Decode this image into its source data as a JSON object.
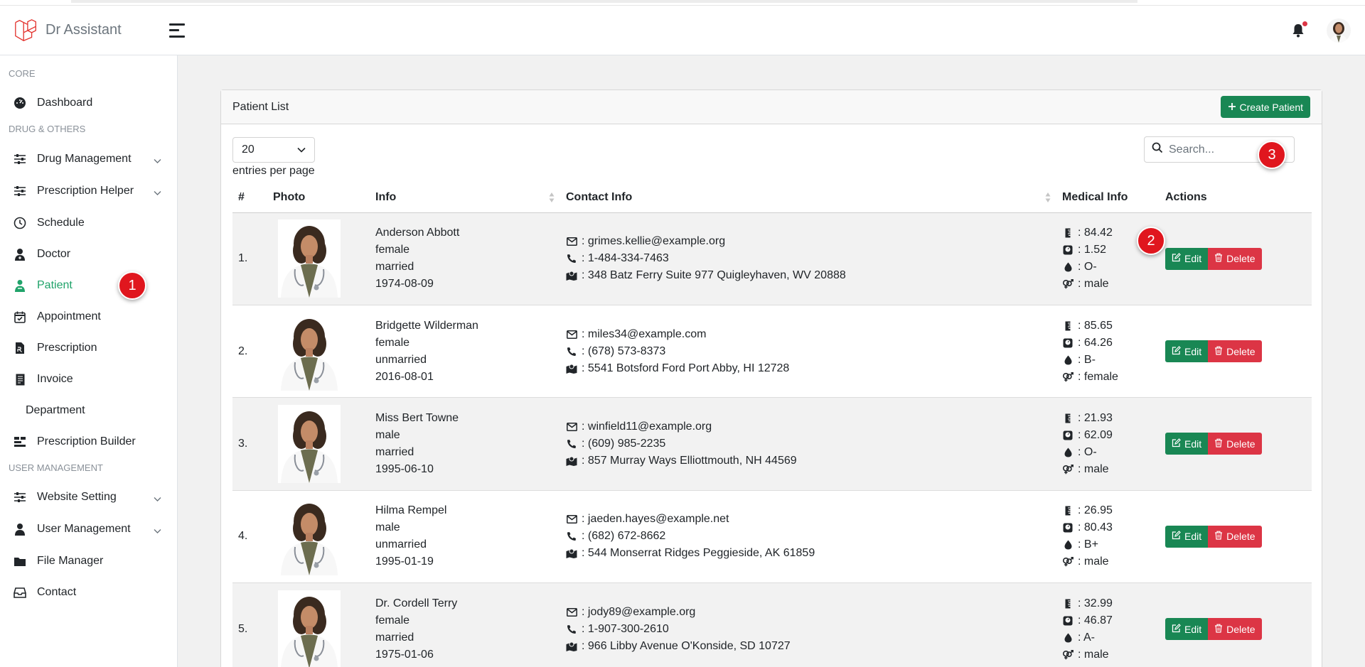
{
  "app": {
    "brand": "Dr Assistant"
  },
  "sidebar": {
    "headings": [
      "CORE",
      "DRUG & OTHERS",
      "USER MANAGEMENT"
    ],
    "items": [
      {
        "label": "Dashboard",
        "icon": "dashboard-icon"
      },
      {
        "label": "Drug Management",
        "icon": "sliders-icon",
        "expandable": true
      },
      {
        "label": "Prescription Helper",
        "icon": "sliders-icon",
        "expandable": true
      },
      {
        "label": "Schedule",
        "icon": "clock-icon"
      },
      {
        "label": "Doctor",
        "icon": "user-doctor-icon"
      },
      {
        "label": "Patient",
        "icon": "patient-icon",
        "active": true
      },
      {
        "label": "Appointment",
        "icon": "calendar-check-icon"
      },
      {
        "label": "Prescription",
        "icon": "file-prescription-icon"
      },
      {
        "label": "Invoice",
        "icon": "invoice-icon"
      },
      {
        "label": "Department",
        "icon": ""
      },
      {
        "label": "Prescription Builder",
        "icon": "builder-icon"
      },
      {
        "label": "Website Setting",
        "icon": "sliders-icon",
        "expandable": true
      },
      {
        "label": "User Management",
        "icon": "user-icon",
        "expandable": true
      },
      {
        "label": "File Manager",
        "icon": "folder-icon"
      },
      {
        "label": "Contact",
        "icon": "inbox-icon"
      }
    ]
  },
  "annotations": [
    "1",
    "2",
    "3"
  ],
  "card": {
    "title": "Patient List",
    "create_label": "Create Patient",
    "per_page_value": "20",
    "per_page_label": "entries per page",
    "search_placeholder": "Search..."
  },
  "table": {
    "headers": [
      "#",
      "Photo",
      "Info",
      "Contact Info",
      "Medical Info",
      "Actions"
    ],
    "edit_label": "Edit",
    "delete_label": "Delete",
    "rows": [
      {
        "num": "1.",
        "name": "Anderson Abbott",
        "gender": "female",
        "marital": "married",
        "dob": "1974-08-09",
        "email": ": grimes.kellie@example.org",
        "phone": ": 1-484-334-7463",
        "address": ": 348 Batz Ferry Suite 977 Quigleyhaven, WV 20888",
        "height": ": 84.42",
        "weight": ": 1.52",
        "blood": ": O-",
        "sex": ": male"
      },
      {
        "num": "2.",
        "name": "Bridgette Wilderman",
        "gender": "female",
        "marital": "unmarried",
        "dob": "2016-08-01",
        "email": ": miles34@example.com",
        "phone": ": (678) 573-8373",
        "address": ": 5541 Botsford Ford Port Abby, HI 12728",
        "height": ": 85.65",
        "weight": ": 64.26",
        "blood": ": B-",
        "sex": ": female"
      },
      {
        "num": "3.",
        "name": "Miss Bert Towne",
        "gender": "male",
        "marital": "married",
        "dob": "1995-06-10",
        "email": ": winfield11@example.org",
        "phone": ": (609) 985-2235",
        "address": ": 857 Murray Ways Elliottmouth, NH 44569",
        "height": ": 21.93",
        "weight": ": 62.09",
        "blood": ": O-",
        "sex": ": male"
      },
      {
        "num": "4.",
        "name": "Hilma Rempel",
        "gender": "male",
        "marital": "unmarried",
        "dob": "1995-01-19",
        "email": ": jaeden.hayes@example.net",
        "phone": ": (682) 672-8662",
        "address": ": 544 Monserrat Ridges Peggieside, AK 61859",
        "height": ": 26.95",
        "weight": ": 80.43",
        "blood": ": B+",
        "sex": ": male"
      },
      {
        "num": "5.",
        "name": "Dr. Cordell Terry",
        "gender": "female",
        "marital": "married",
        "dob": "1975-01-06",
        "email": ": jody89@example.org",
        "phone": ": 1-907-300-2610",
        "address": ": 966 Libby Avenue O'Konside, SD 10727",
        "height": ": 32.99",
        "weight": ": 46.87",
        "blood": ": A-",
        "sex": ": male"
      }
    ]
  },
  "colors": {
    "primary_green": "#198754",
    "danger_red": "#dc3545",
    "active_green": "#20a36a",
    "badge_red": "#e0161e"
  }
}
